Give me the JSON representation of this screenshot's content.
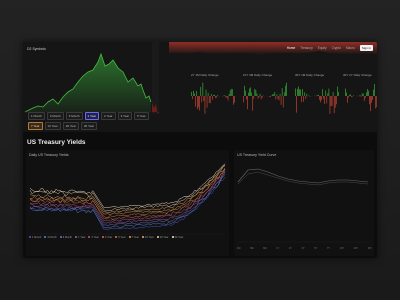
{
  "app": {
    "title": "D2 Symbols"
  },
  "nav": {
    "items": [
      "Home",
      "Treasury",
      "Equity",
      "Crypto",
      "Macro"
    ],
    "cta": "Sign in"
  },
  "ranges": [
    "1 Month",
    "3 Month",
    "6 Month",
    "1 Year",
    "2 Year",
    "3 Year",
    "5 Year",
    "7 Year",
    "10 Year",
    "20 Year",
    "30 Year"
  ],
  "cards": {
    "labels": [
      "2Y 1M Daily Change",
      "10Y 3M Daily Change",
      "30Y 1M Daily Change",
      "30Y 2Y Daily Change"
    ]
  },
  "section": {
    "title": "US Treasury Yields"
  },
  "panels": {
    "yields_title": "Daily US Treasury Yields",
    "curve_title": "US Treasury Yield Curve"
  },
  "legend": [
    "1 Month",
    "3 Month",
    "6 Month",
    "1 Year",
    "2 Year",
    "3 Year",
    "5 Year",
    "7 Year",
    "10 Year",
    "20 Year",
    "30 Year"
  ],
  "curve": {
    "ticks": [
      "1M",
      "3M",
      "6M",
      "1Y",
      "2Y",
      "3Y",
      "5Y",
      "7Y",
      "10Y",
      "20Y",
      "30Y"
    ]
  },
  "colors": {
    "accent_green": "#3fbf3f",
    "accent_red": "#e04b3b",
    "accent_purple": "#6a6af0",
    "accent_orange": "#ff8c42"
  }
}
